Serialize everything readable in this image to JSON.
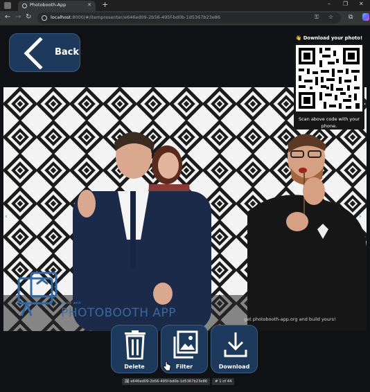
{
  "browser": {
    "tab_title": "Photobooth-App",
    "tab_close": "✕",
    "new_tab": "+",
    "url_host": "localhost",
    "url_rest": ":8000/#/itempresenter/e646ed09-2b56-495f-bd0b-1d5367b23e86",
    "window_controls": [
      "–",
      "❐",
      "✕"
    ],
    "nav_icons": [
      "arrow-left-icon",
      "arrow-right-icon",
      "reload-icon"
    ]
  },
  "page": {
    "back_label": "Back",
    "qr": {
      "heading": "👋 Download your photo!",
      "caption": "Scan above code with your phone."
    },
    "watermark": {
      "made_with": "made with",
      "app_name": "PHOTOBOOTH APP",
      "link": "get photobooth-app.org and build yours!"
    },
    "actions": [
      {
        "label": "Delete",
        "icon": "trash-icon"
      },
      {
        "label": "Filter",
        "icon": "image-icon"
      },
      {
        "label": "Download",
        "icon": "download-icon"
      }
    ],
    "footer": {
      "item_id": "🖼 e646ed09-2b56-495f-bd0b-1d5367b23e86",
      "count": "# 1 of 44"
    }
  },
  "colors": {
    "accent": "#1d3a5c",
    "page_bg": "#101114"
  }
}
